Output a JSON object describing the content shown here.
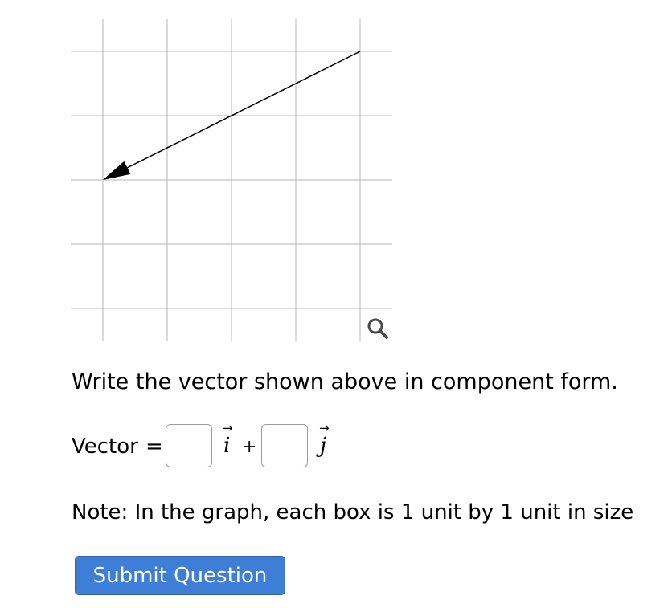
{
  "graph": {
    "grid_columns": 5,
    "grid_rows": 5,
    "vector": {
      "tail": [
        4,
        4
      ],
      "head": [
        0,
        2
      ]
    },
    "colors": {
      "grid": "#b5b5b5",
      "vector": "#000000"
    },
    "zoom_icon": "magnifier-icon"
  },
  "question": {
    "prompt": "Write the vector shown above in component form.",
    "vector_label": "Vector",
    "equals": "=",
    "plus": "+",
    "unit_arrow": "→",
    "unit_i": "i",
    "unit_j": "j",
    "answer_i": "",
    "answer_j": "",
    "note": "Note: In the graph, each box is 1 unit by 1 unit in size"
  },
  "submit": {
    "label": "Submit Question",
    "color": "#3f7ed6"
  }
}
